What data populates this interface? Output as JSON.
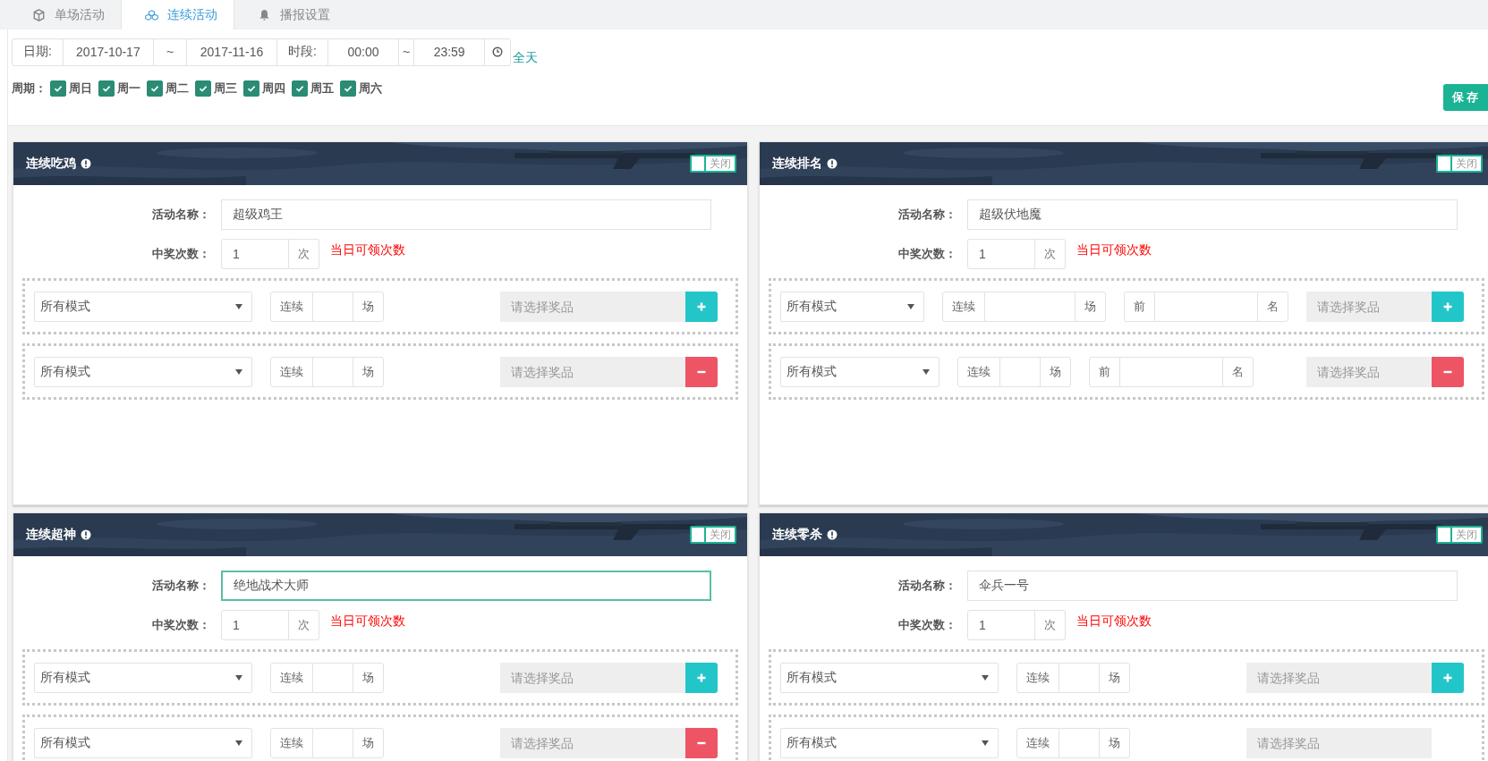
{
  "tabs": [
    {
      "label": "单场活动",
      "selected": false
    },
    {
      "label": "连续活动",
      "selected": true
    },
    {
      "label": "播报设置",
      "selected": false
    }
  ],
  "filter": {
    "date_label": "日期:",
    "start_date": "2017-10-17",
    "date_sep": "~",
    "end_date": "2017-11-16",
    "time_label": "时段:",
    "start_time": "00:00",
    "time_sep": "~",
    "end_time": "23:59",
    "all_day_link": "全天"
  },
  "week": {
    "label": "周期：",
    "days": [
      {
        "label": "周日",
        "checked": true
      },
      {
        "label": "周一",
        "checked": true
      },
      {
        "label": "周二",
        "checked": true
      },
      {
        "label": "周三",
        "checked": true
      },
      {
        "label": "周四",
        "checked": true
      },
      {
        "label": "周五",
        "checked": true
      },
      {
        "label": "周六",
        "checked": true
      }
    ]
  },
  "save_button": "保存",
  "panels": [
    {
      "title": "连续吃鸡",
      "toggle": {
        "on": false,
        "label": "关闭"
      },
      "name_label": "活动名称：",
      "name_value": "超级鸡王",
      "name_focused": false,
      "count_label": "中奖次数：",
      "count_value": "1",
      "count_unit": "次",
      "count_hint": "当日可领次数",
      "rows": [
        {
          "mode": "所有模式",
          "streak_prefix": "连续",
          "streak_suffix": "场",
          "prize_placeholder": "请选择奖品",
          "kind": "add"
        },
        {
          "mode": "所有模式",
          "streak_prefix": "连续",
          "streak_suffix": "场",
          "prize_placeholder": "请选择奖品",
          "kind": "remove"
        }
      ]
    },
    {
      "title": "连续排名",
      "toggle": {
        "on": false,
        "label": "关闭"
      },
      "name_label": "活动名称：",
      "name_value": "超级伏地魔",
      "name_focused": false,
      "count_label": "中奖次数：",
      "count_value": "1",
      "count_unit": "次",
      "count_hint": "当日可领次数",
      "rows": [
        {
          "mode": "所有模式",
          "streak_prefix": "连续",
          "streak_suffix": "场",
          "rank_prefix": "前",
          "rank_suffix": "名",
          "prize_placeholder": "请选择奖品",
          "kind": "add"
        },
        {
          "mode": "所有模式",
          "streak_prefix": "连续",
          "streak_suffix": "场",
          "rank_prefix": "前",
          "rank_suffix": "名",
          "prize_placeholder": "请选择奖品",
          "kind": "remove"
        }
      ]
    },
    {
      "title": "连续超神",
      "toggle": {
        "on": false,
        "label": "关闭"
      },
      "name_label": "活动名称：",
      "name_value": "绝地战术大师",
      "name_focused": true,
      "count_label": "中奖次数：",
      "count_value": "1",
      "count_unit": "次",
      "count_hint": "当日可领次数",
      "rows": [
        {
          "mode": "所有模式",
          "streak_prefix": "连续",
          "streak_suffix": "场",
          "prize_placeholder": "请选择奖品",
          "kind": "add"
        },
        {
          "mode": "所有模式",
          "streak_prefix": "连续",
          "streak_suffix": "场",
          "prize_placeholder": "请选择奖品",
          "kind": "remove"
        }
      ]
    },
    {
      "title": "连续零杀",
      "toggle": {
        "on": false,
        "label": "关闭"
      },
      "name_label": "活动名称：",
      "name_value": "伞兵一号",
      "name_focused": false,
      "count_label": "中奖次数：",
      "count_value": "1",
      "count_unit": "次",
      "count_hint": "当日可领次数",
      "rows": [
        {
          "mode": "所有模式",
          "streak_prefix": "连续",
          "streak_suffix": "场",
          "prize_placeholder": "请选择奖品",
          "kind": "add"
        },
        {
          "mode": "所有模式",
          "streak_prefix": "连续",
          "streak_suffix": "场",
          "prize_placeholder": "请选择奖品",
          "kind": "none"
        }
      ]
    }
  ]
}
